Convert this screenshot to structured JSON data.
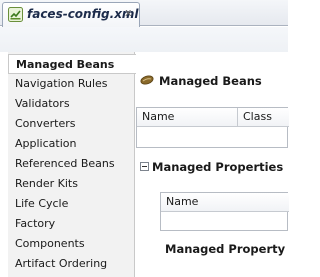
{
  "tab": {
    "title": "faces-config.xml",
    "close_glyph": "x",
    "icon": "faces-config-file-icon"
  },
  "sidebar": {
    "items": [
      {
        "label": "Managed Beans",
        "selected": true
      },
      {
        "label": "Navigation Rules"
      },
      {
        "label": "Validators"
      },
      {
        "label": "Converters"
      },
      {
        "label": "Application"
      },
      {
        "label": "Referenced Beans"
      },
      {
        "label": "Render Kits"
      },
      {
        "label": "Life Cycle"
      },
      {
        "label": "Factory"
      },
      {
        "label": "Components"
      },
      {
        "label": "Artifact Ordering"
      }
    ]
  },
  "main": {
    "beans_section": {
      "icon": "bean-icon",
      "title": "Managed Beans",
      "columns": [
        "Name",
        "Class"
      ]
    },
    "properties_section": {
      "toggle_glyph": "−",
      "title": "Managed Properties",
      "columns": [
        "Name"
      ],
      "footer_label": "Managed Property"
    }
  },
  "colors": {
    "tab_bar": "#e6e9ef",
    "sidebar_bg": "#f2f2f2",
    "border": "#b7bcc4",
    "bean_icon": "#8a6a2a"
  }
}
